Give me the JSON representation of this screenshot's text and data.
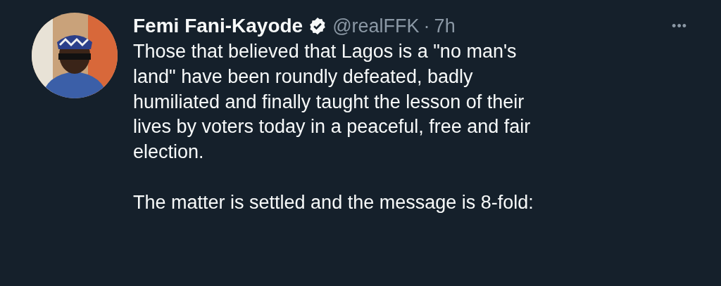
{
  "tweet": {
    "author": {
      "name": "Femi Fani-Kayode",
      "verified": true,
      "handle": "@realFFK",
      "separator": "·",
      "time": "7h"
    },
    "more": "•••",
    "paragraphs": [
      "Those that believed that Lagos is a \"no man's\nland\" have been roundly defeated, badly\nhumiliated and finally taught the lesson of their\nlives by voters today in a peaceful, free and fair\nelection.",
      "The matter is settled and the message is 8-fold:"
    ]
  }
}
